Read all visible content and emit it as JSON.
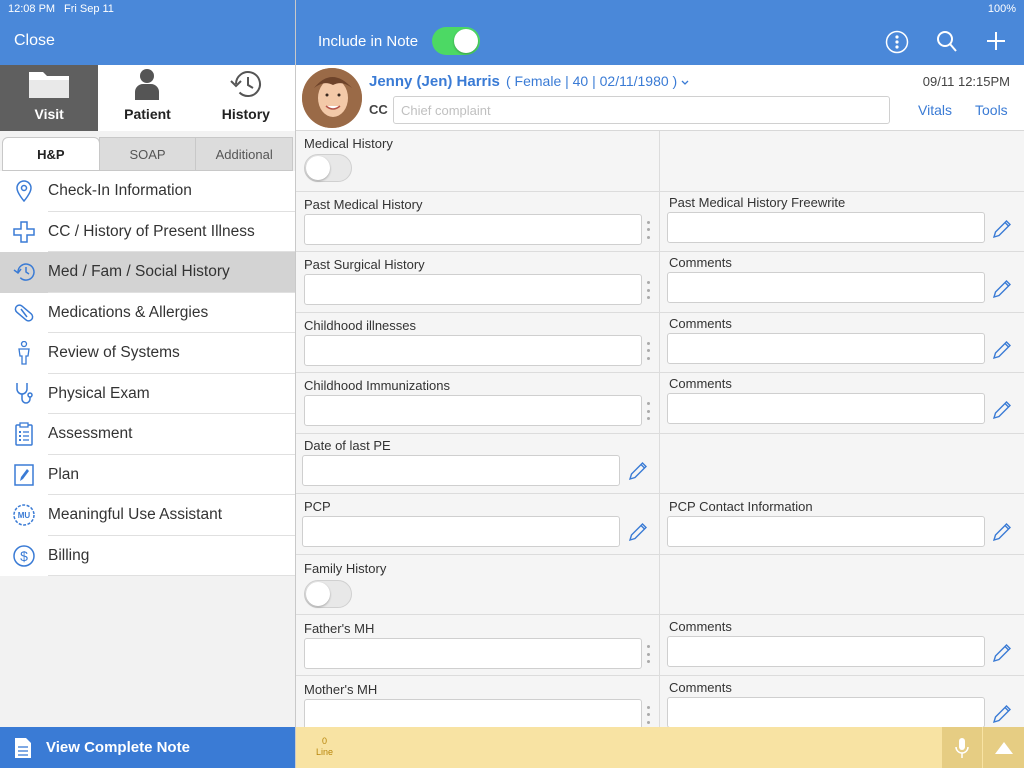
{
  "status": {
    "time": "12:08 PM",
    "date": "Fri Sep 11",
    "battery": "100%"
  },
  "left": {
    "close_label": "Close",
    "top_tabs": [
      {
        "label": "Visit",
        "icon": "folder-icon",
        "active": true
      },
      {
        "label": "Patient",
        "icon": "person-icon",
        "active": false
      },
      {
        "label": "History",
        "icon": "history-icon",
        "active": false
      }
    ],
    "segments": [
      {
        "label": "H&P",
        "active": true
      },
      {
        "label": "SOAP",
        "active": false
      },
      {
        "label": "Additional",
        "active": false
      }
    ],
    "menu": [
      {
        "label": "Check-In Information",
        "icon": "location-pin-icon"
      },
      {
        "label": "CC / History of Present Illness",
        "icon": "medical-cross-icon"
      },
      {
        "label": "Med / Fam / Social History",
        "icon": "history-clock-icon",
        "active": true
      },
      {
        "label": "Medications & Allergies",
        "icon": "pill-icon"
      },
      {
        "label": "Review of Systems",
        "icon": "body-icon"
      },
      {
        "label": "Physical Exam",
        "icon": "stethoscope-icon"
      },
      {
        "label": "Assessment",
        "icon": "clipboard-icon"
      },
      {
        "label": "Plan",
        "icon": "pen-icon"
      },
      {
        "label": "Meaningful Use Assistant",
        "icon": "mu-badge-icon"
      },
      {
        "label": "Billing",
        "icon": "dollar-icon"
      }
    ],
    "view_note_label": "View Complete Note"
  },
  "header": {
    "include_label": "Include in Note",
    "include_on": true
  },
  "patient": {
    "name": "Jenny (Jen) Harris",
    "info": "( Female | 40 | 02/11/1980 )",
    "cc_label": "CC",
    "cc_placeholder": "Chief complaint",
    "timestamp": "09/11 12:15PM",
    "vitals_label": "Vitals",
    "tools_label": "Tools"
  },
  "form": {
    "medical_history_label": "Medical History",
    "past_medical_label": "Past Medical History",
    "past_medical_freewrite_label": "Past Medical History Freewrite",
    "past_surgical_label": "Past Surgical History",
    "childhood_illnesses_label": "Childhood illnesses",
    "childhood_immunizations_label": "Childhood Immunizations",
    "comments_label": "Comments",
    "date_last_pe_label": "Date of last PE",
    "pcp_label": "PCP",
    "pcp_contact_label": "PCP Contact Information",
    "family_history_label": "Family History",
    "fathers_mh_label": "Father's MH",
    "mothers_mh_label": "Mother's MH"
  },
  "bottom": {
    "line_count": "0",
    "line_label": "Line"
  },
  "colors": {
    "header_blue": "#4a88d9",
    "link_blue": "#3a7bd5",
    "toggle_green": "#4cd964",
    "bottom_yellow": "#f8e3a3"
  }
}
